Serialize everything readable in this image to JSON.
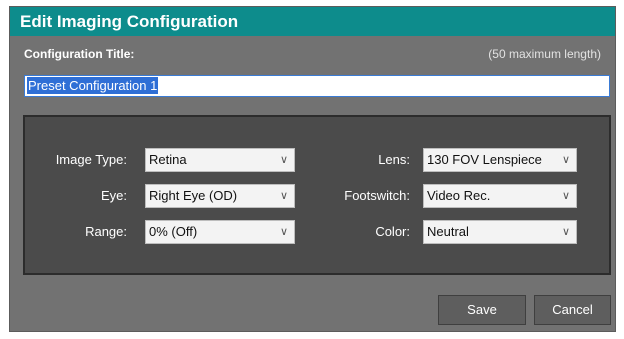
{
  "dialog": {
    "title": "Edit Imaging Configuration",
    "accent_color": "#0d8c8c",
    "config_title_label": "Configuration Title:",
    "config_title_hint": "(50 maximum length)",
    "config_title_value": "Preset Configuration 1"
  },
  "fields": {
    "image_type": {
      "label": "Image Type:",
      "value": "Retina"
    },
    "eye": {
      "label": "Eye:",
      "value": "Right Eye (OD)"
    },
    "range": {
      "label": "Range:",
      "value": "0% (Off)"
    },
    "lens": {
      "label": "Lens:",
      "value": "130 FOV Lenspiece"
    },
    "footswitch": {
      "label": "Footswitch:",
      "value": "Video Rec."
    },
    "color": {
      "label": "Color:",
      "value": "Neutral"
    }
  },
  "buttons": {
    "save": "Save",
    "cancel": "Cancel"
  },
  "icons": {
    "dropdown": "chevron-down-icon"
  }
}
